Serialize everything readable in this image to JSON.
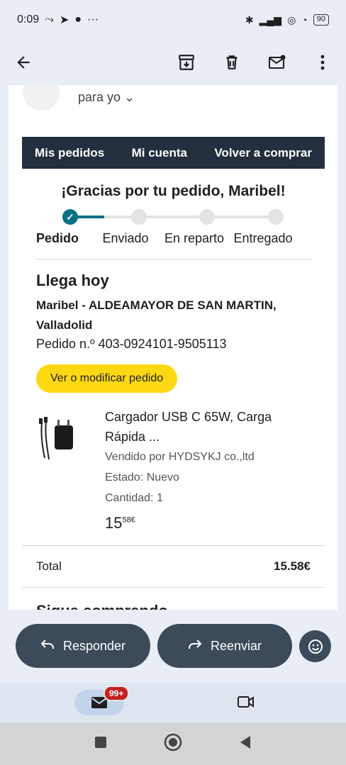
{
  "status": {
    "time": "0:09",
    "more": "···",
    "battery": "90"
  },
  "email": {
    "to_label": "para yo",
    "nav": [
      "Mis pedidos",
      "Mi cuenta",
      "Volver a comprar"
    ],
    "thanks": "¡Gracias por tu pedido, Maribel!",
    "steps": [
      "Pedido",
      "Enviado",
      "En reparto",
      "Entregado"
    ],
    "current_step": 1,
    "arrival": "Llega hoy",
    "address_line1": "Maribel - ALDEAMAYOR DE SAN MARTIN,",
    "address_line2": "Valladolid",
    "order_number": "Pedido n.º 403-0924101-9505113",
    "order_button": "Ver o modificar pedido",
    "item": {
      "title_line1": "Cargador USB C 65W, Carga",
      "title_line2": "Rápida ...",
      "seller": "Vendido por HYDSYKJ co.,ltd",
      "condition": "Estado: Nuevo",
      "quantity": "Cantidad: 1",
      "price_whole": "15",
      "price_fraction": "58€"
    },
    "total_label": "Total",
    "total_value": "15.58€",
    "more_heading": "Sigue comprando"
  },
  "actions": {
    "reply": "Responder",
    "forward": "Reenviar"
  },
  "bottom_nav": {
    "mail_badge": "99+"
  },
  "colors": {
    "amazon_nav": "#232f3e",
    "accent_teal": "#007185",
    "button_yellow": "#ffd814",
    "pill_dark": "#3c4a5a",
    "badge_red": "#c5221f"
  }
}
